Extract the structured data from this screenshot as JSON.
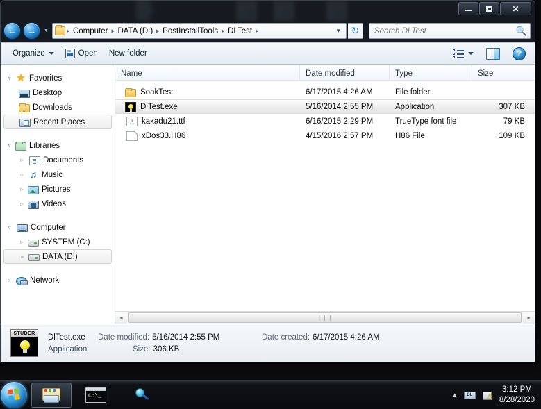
{
  "window": {
    "controls": {
      "minimize": "–",
      "maximize": "□",
      "close": "✕"
    }
  },
  "address_bar": {
    "back_icon": "back-arrow-icon",
    "forward_icon": "forward-arrow-icon",
    "history_caret": "▼",
    "breadcrumbs": [
      "Computer",
      "DATA (D:)",
      "PostInstallTools",
      "DLTest"
    ],
    "separator": "▸",
    "dropdown_caret": "▼",
    "refresh_icon": "↻"
  },
  "search": {
    "placeholder": "Search DLTest",
    "icon": "search-icon"
  },
  "toolbar": {
    "organize_label": "Organize",
    "open_label": "Open",
    "new_folder_label": "New folder",
    "view_icon": "list-view-icon",
    "view_caret": "▼",
    "preview_pane_icon": "preview-pane-icon",
    "help_label": "?"
  },
  "nav_pane": {
    "groups": [
      {
        "name": "Favorites",
        "icon": "star-icon",
        "expanded": true,
        "items": [
          {
            "label": "Desktop",
            "icon": "desktop-icon",
            "selected": false
          },
          {
            "label": "Downloads",
            "icon": "downloads-folder-icon",
            "selected": false
          },
          {
            "label": "Recent Places",
            "icon": "recent-places-icon",
            "selected": true
          }
        ]
      },
      {
        "name": "Libraries",
        "icon": "libraries-icon",
        "expanded": true,
        "items": [
          {
            "label": "Documents",
            "icon": "documents-icon",
            "selected": false
          },
          {
            "label": "Music",
            "icon": "music-icon",
            "selected": false
          },
          {
            "label": "Pictures",
            "icon": "pictures-icon",
            "selected": false
          },
          {
            "label": "Videos",
            "icon": "videos-icon",
            "selected": false
          }
        ]
      },
      {
        "name": "Computer",
        "icon": "computer-icon",
        "expanded": true,
        "items": [
          {
            "label": "SYSTEM (C:)",
            "icon": "drive-icon",
            "selected": false
          },
          {
            "label": "DATA (D:)",
            "icon": "drive-icon",
            "selected": true
          }
        ]
      },
      {
        "name": "Network",
        "icon": "network-icon",
        "expanded": false,
        "items": []
      }
    ]
  },
  "file_list": {
    "columns": [
      "Name",
      "Date modified",
      "Type",
      "Size"
    ],
    "sort_column": "Name",
    "sort_direction": "ascending",
    "rows": [
      {
        "name": "SoakTest",
        "date_modified": "6/17/2015 4:26 AM",
        "type": "File folder",
        "size": "",
        "icon": "folder-icon",
        "selected": false
      },
      {
        "name": "DlTest.exe",
        "date_modified": "5/16/2014 2:55 PM",
        "type": "Application",
        "size": "307 KB",
        "icon": "lightbulb-application-icon",
        "selected": true
      },
      {
        "name": "kakadu21.ttf",
        "date_modified": "6/16/2015 2:29 PM",
        "type": "TrueType font file",
        "size": "79 KB",
        "icon": "truetype-font-icon",
        "selected": false
      },
      {
        "name": "xDos33.H86",
        "date_modified": "4/15/2016 2:57 PM",
        "type": "H86 File",
        "size": "109 KB",
        "icon": "generic-file-icon",
        "selected": false
      }
    ]
  },
  "scrollbar": {
    "left_arrow": "◂",
    "right_arrow": "▸",
    "grip": "❘❘❘"
  },
  "details_pane": {
    "icon_badge": "STUDER",
    "file_name": "DlTest.exe",
    "file_type": "Application",
    "date_modified_label": "Date modified:",
    "date_modified_value": "5/16/2014 2:55 PM",
    "date_created_label": "Date created:",
    "date_created_value": "6/17/2015 4:26 AM",
    "size_label": "Size:",
    "size_value": "306 KB"
  },
  "taskbar": {
    "start_label": "start-orb",
    "items": [
      {
        "name": "windows-explorer",
        "icon": "explorer-folder-icon",
        "active": true
      },
      {
        "name": "command-prompt",
        "icon": "command-prompt-icon",
        "active": false
      },
      {
        "name": "network-search",
        "icon": "magnifier-globe-icon",
        "active": false
      }
    ],
    "tray": {
      "show_hidden_caret": "▲",
      "icons": [
        "dl-tray-icon",
        "action-center-warning-icon"
      ],
      "time": "3:12 PM",
      "date": "8/28/2020"
    }
  }
}
